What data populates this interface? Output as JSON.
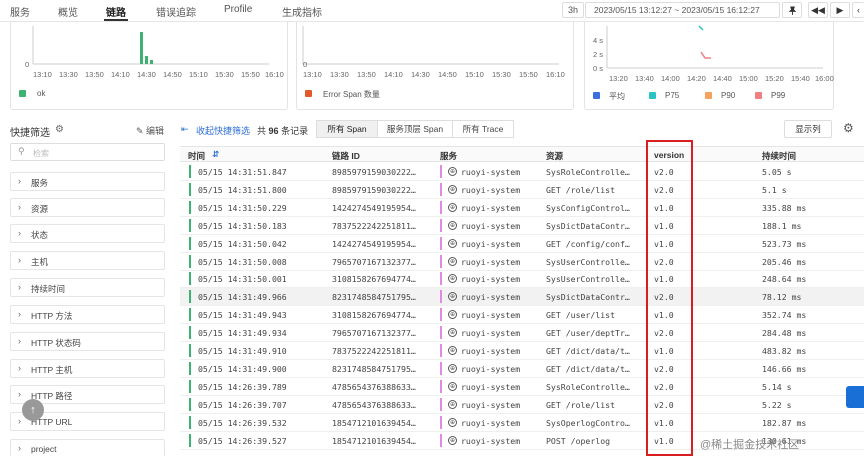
{
  "nav": {
    "tabs": [
      {
        "label": "服务"
      },
      {
        "label": "概览"
      },
      {
        "label": "链路"
      },
      {
        "label": "错误追踪"
      },
      {
        "label": "Profile"
      },
      {
        "label": "生成指标"
      }
    ],
    "active_tab": "链路",
    "quick_range": "3h",
    "time_range": "2023/05/15 13:12:27 ~ 2023/05/15 16:12:27"
  },
  "charts": [
    {
      "chart_data": {
        "type": "bar",
        "y_ticks": [
          "0"
        ],
        "categories": [
          "13:10",
          "13:30",
          "13:50",
          "14:10",
          "14:30",
          "14:50",
          "15:10",
          "15:30",
          "15:50",
          "16:10"
        ],
        "series": [
          {
            "name": "ok",
            "color": "#3cb371"
          }
        ]
      }
    },
    {
      "chart_data": {
        "type": "bar",
        "y_ticks": [
          "0"
        ],
        "categories": [
          "13:10",
          "13:30",
          "13:50",
          "14:10",
          "14:30",
          "14:50",
          "15:10",
          "15:30",
          "15:50",
          "16:10"
        ],
        "series": [
          {
            "name": "Error Span 数量",
            "color": "#e05a2b"
          }
        ]
      }
    },
    {
      "chart_data": {
        "type": "line",
        "y_ticks": [
          "4 s",
          "2 s",
          "0 s"
        ],
        "categories": [
          "13:20",
          "13:40",
          "14:00",
          "14:20",
          "14:40",
          "15:00",
          "15:20",
          "15:40",
          "16:00"
        ],
        "series": [
          {
            "name": "平均",
            "color": "#3b6fe0"
          },
          {
            "name": "P75",
            "color": "#2bc4c4"
          },
          {
            "name": "P90",
            "color": "#f5a35c"
          },
          {
            "name": "P99",
            "color": "#f08080"
          }
        ]
      }
    }
  ],
  "filter": {
    "title": "快捷筛选",
    "edit_label": "编辑",
    "search_placeholder": "检索",
    "items": [
      "服务",
      "资源",
      "状态",
      "主机",
      "持续时间",
      "HTTP 方法",
      "HTTP 状态码",
      "HTTP 主机",
      "HTTP 路径",
      "HTTP URL",
      "project"
    ]
  },
  "toolbar": {
    "collapse_label": "收起快捷筛选",
    "count_prefix": "共",
    "count": "96",
    "count_suffix": "条记录",
    "tabs": [
      "所有 Span",
      "服务顶层 Span",
      "所有 Trace"
    ],
    "display_columns": "显示列"
  },
  "table": {
    "headers": [
      "时间",
      "链路 ID",
      "服务",
      "资源",
      "version",
      "持续时间"
    ],
    "rows": [
      {
        "time": "05/15 14:31:51.847",
        "trace": "8985979159030222…",
        "service": "ruoyi-system",
        "resource": "SysRoleControlle…",
        "version": "v2.0",
        "duration": "5.05 s"
      },
      {
        "time": "05/15 14:31:51.800",
        "trace": "8985979159030222…",
        "service": "ruoyi-system",
        "resource": "GET /role/list",
        "version": "v2.0",
        "duration": "5.1 s"
      },
      {
        "time": "05/15 14:31:50.229",
        "trace": "1424274549195954…",
        "service": "ruoyi-system",
        "resource": "SysConfigControl…",
        "version": "v1.0",
        "duration": "335.88 ms"
      },
      {
        "time": "05/15 14:31:50.183",
        "trace": "7837522242251811…",
        "service": "ruoyi-system",
        "resource": "SysDictDataContr…",
        "version": "v1.0",
        "duration": "188.1 ms"
      },
      {
        "time": "05/15 14:31:50.042",
        "trace": "1424274549195954…",
        "service": "ruoyi-system",
        "resource": "GET /config/conf…",
        "version": "v1.0",
        "duration": "523.73 ms"
      },
      {
        "time": "05/15 14:31:50.008",
        "trace": "7965707167132377…",
        "service": "ruoyi-system",
        "resource": "SysUserControlle…",
        "version": "v2.0",
        "duration": "205.46 ms"
      },
      {
        "time": "05/15 14:31:50.001",
        "trace": "3108158267694774…",
        "service": "ruoyi-system",
        "resource": "SysUserControlle…",
        "version": "v1.0",
        "duration": "248.64 ms"
      },
      {
        "time": "05/15 14:31:49.966",
        "trace": "8231748584751795…",
        "service": "ruoyi-system",
        "resource": "SysDictDataContr…",
        "version": "v2.0",
        "duration": "78.12 ms"
      },
      {
        "time": "05/15 14:31:49.943",
        "trace": "3108158267694774…",
        "service": "ruoyi-system",
        "resource": "GET /user/list",
        "version": "v1.0",
        "duration": "352.74 ms"
      },
      {
        "time": "05/15 14:31:49.934",
        "trace": "7965707167132377…",
        "service": "ruoyi-system",
        "resource": "GET /user/deptTr…",
        "version": "v2.0",
        "duration": "284.48 ms"
      },
      {
        "time": "05/15 14:31:49.910",
        "trace": "7837522242251811…",
        "service": "ruoyi-system",
        "resource": "GET /dict/data/t…",
        "version": "v1.0",
        "duration": "483.82 ms"
      },
      {
        "time": "05/15 14:31:49.900",
        "trace": "8231748584751795…",
        "service": "ruoyi-system",
        "resource": "GET /dict/data/t…",
        "version": "v2.0",
        "duration": "146.66 ms"
      },
      {
        "time": "05/15 14:26:39.789",
        "trace": "4785654376388633…",
        "service": "ruoyi-system",
        "resource": "SysRoleControlle…",
        "version": "v2.0",
        "duration": "5.14 s"
      },
      {
        "time": "05/15 14:26:39.707",
        "trace": "4785654376388633…",
        "service": "ruoyi-system",
        "resource": "GET /role/list",
        "version": "v2.0",
        "duration": "5.22 s"
      },
      {
        "time": "05/15 14:26:39.532",
        "trace": "1854712101639454…",
        "service": "ruoyi-system",
        "resource": "SysOperlogContro…",
        "version": "v1.0",
        "duration": "182.87 ms"
      },
      {
        "time": "05/15 14:26:39.527",
        "trace": "1854712101639454…",
        "service": "ruoyi-system",
        "resource": "POST /operlog",
        "version": "v1.0",
        "duration": "130.61 ms"
      }
    ]
  },
  "watermark": "@稀土掘金技术社区",
  "colors": {
    "ok": "#3cb371",
    "accent": "#2e6fd8",
    "highlight": "#d81e1e",
    "service": "#e08be0"
  }
}
